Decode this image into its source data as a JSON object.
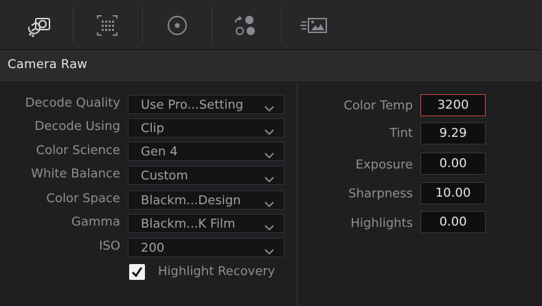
{
  "toolbar": {
    "tabs": [
      {
        "icon": "camera-raw-icon"
      },
      {
        "icon": "frame-grid-icon"
      },
      {
        "icon": "target-circle-icon"
      },
      {
        "icon": "node-graph-icon"
      },
      {
        "icon": "image-sizing-icon"
      }
    ]
  },
  "panel": {
    "title": "Camera Raw"
  },
  "left": {
    "rows": [
      {
        "label": "Decode Quality",
        "value": "Use Pro...Setting"
      },
      {
        "label": "Decode Using",
        "value": "Clip"
      },
      {
        "label": "Color Science",
        "value": "Gen 4"
      },
      {
        "label": "White Balance",
        "value": "Custom"
      },
      {
        "label": "Color Space",
        "value": "Blackm...Design"
      },
      {
        "label": "Gamma",
        "value": "Blackm...K Film"
      },
      {
        "label": "ISO",
        "value": "200"
      }
    ],
    "highlight_recovery": {
      "label": "Highlight Recovery",
      "checked": true
    }
  },
  "right": {
    "fields": [
      {
        "label": "Color Temp",
        "value": "3200"
      },
      {
        "label": "Tint",
        "value": "9.29"
      },
      {
        "label": "Exposure",
        "value": "0.00"
      },
      {
        "label": "Sharpness",
        "value": "10.00"
      },
      {
        "label": "Highlights",
        "value": "0.00"
      }
    ]
  },
  "colors": {
    "accent_active_border": "#d24b3c",
    "panel_bg": "#1f1f21",
    "text_muted": "#8f8f93",
    "text_bright": "#e6e6e6"
  }
}
